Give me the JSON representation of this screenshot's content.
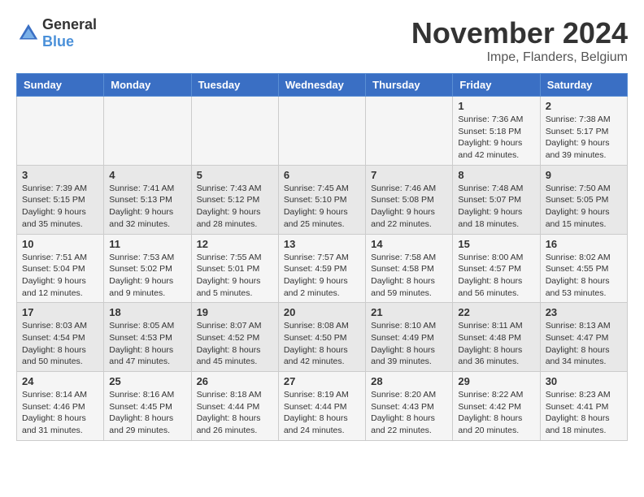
{
  "header": {
    "logo_general": "General",
    "logo_blue": "Blue",
    "title": "November 2024",
    "location": "Impe, Flanders, Belgium"
  },
  "days_of_week": [
    "Sunday",
    "Monday",
    "Tuesday",
    "Wednesday",
    "Thursday",
    "Friday",
    "Saturday"
  ],
  "weeks": [
    [
      {
        "day": "",
        "info": ""
      },
      {
        "day": "",
        "info": ""
      },
      {
        "day": "",
        "info": ""
      },
      {
        "day": "",
        "info": ""
      },
      {
        "day": "",
        "info": ""
      },
      {
        "day": "1",
        "info": "Sunrise: 7:36 AM\nSunset: 5:18 PM\nDaylight: 9 hours and 42 minutes."
      },
      {
        "day": "2",
        "info": "Sunrise: 7:38 AM\nSunset: 5:17 PM\nDaylight: 9 hours and 39 minutes."
      }
    ],
    [
      {
        "day": "3",
        "info": "Sunrise: 7:39 AM\nSunset: 5:15 PM\nDaylight: 9 hours and 35 minutes."
      },
      {
        "day": "4",
        "info": "Sunrise: 7:41 AM\nSunset: 5:13 PM\nDaylight: 9 hours and 32 minutes."
      },
      {
        "day": "5",
        "info": "Sunrise: 7:43 AM\nSunset: 5:12 PM\nDaylight: 9 hours and 28 minutes."
      },
      {
        "day": "6",
        "info": "Sunrise: 7:45 AM\nSunset: 5:10 PM\nDaylight: 9 hours and 25 minutes."
      },
      {
        "day": "7",
        "info": "Sunrise: 7:46 AM\nSunset: 5:08 PM\nDaylight: 9 hours and 22 minutes."
      },
      {
        "day": "8",
        "info": "Sunrise: 7:48 AM\nSunset: 5:07 PM\nDaylight: 9 hours and 18 minutes."
      },
      {
        "day": "9",
        "info": "Sunrise: 7:50 AM\nSunset: 5:05 PM\nDaylight: 9 hours and 15 minutes."
      }
    ],
    [
      {
        "day": "10",
        "info": "Sunrise: 7:51 AM\nSunset: 5:04 PM\nDaylight: 9 hours and 12 minutes."
      },
      {
        "day": "11",
        "info": "Sunrise: 7:53 AM\nSunset: 5:02 PM\nDaylight: 9 hours and 9 minutes."
      },
      {
        "day": "12",
        "info": "Sunrise: 7:55 AM\nSunset: 5:01 PM\nDaylight: 9 hours and 5 minutes."
      },
      {
        "day": "13",
        "info": "Sunrise: 7:57 AM\nSunset: 4:59 PM\nDaylight: 9 hours and 2 minutes."
      },
      {
        "day": "14",
        "info": "Sunrise: 7:58 AM\nSunset: 4:58 PM\nDaylight: 8 hours and 59 minutes."
      },
      {
        "day": "15",
        "info": "Sunrise: 8:00 AM\nSunset: 4:57 PM\nDaylight: 8 hours and 56 minutes."
      },
      {
        "day": "16",
        "info": "Sunrise: 8:02 AM\nSunset: 4:55 PM\nDaylight: 8 hours and 53 minutes."
      }
    ],
    [
      {
        "day": "17",
        "info": "Sunrise: 8:03 AM\nSunset: 4:54 PM\nDaylight: 8 hours and 50 minutes."
      },
      {
        "day": "18",
        "info": "Sunrise: 8:05 AM\nSunset: 4:53 PM\nDaylight: 8 hours and 47 minutes."
      },
      {
        "day": "19",
        "info": "Sunrise: 8:07 AM\nSunset: 4:52 PM\nDaylight: 8 hours and 45 minutes."
      },
      {
        "day": "20",
        "info": "Sunrise: 8:08 AM\nSunset: 4:50 PM\nDaylight: 8 hours and 42 minutes."
      },
      {
        "day": "21",
        "info": "Sunrise: 8:10 AM\nSunset: 4:49 PM\nDaylight: 8 hours and 39 minutes."
      },
      {
        "day": "22",
        "info": "Sunrise: 8:11 AM\nSunset: 4:48 PM\nDaylight: 8 hours and 36 minutes."
      },
      {
        "day": "23",
        "info": "Sunrise: 8:13 AM\nSunset: 4:47 PM\nDaylight: 8 hours and 34 minutes."
      }
    ],
    [
      {
        "day": "24",
        "info": "Sunrise: 8:14 AM\nSunset: 4:46 PM\nDaylight: 8 hours and 31 minutes."
      },
      {
        "day": "25",
        "info": "Sunrise: 8:16 AM\nSunset: 4:45 PM\nDaylight: 8 hours and 29 minutes."
      },
      {
        "day": "26",
        "info": "Sunrise: 8:18 AM\nSunset: 4:44 PM\nDaylight: 8 hours and 26 minutes."
      },
      {
        "day": "27",
        "info": "Sunrise: 8:19 AM\nSunset: 4:44 PM\nDaylight: 8 hours and 24 minutes."
      },
      {
        "day": "28",
        "info": "Sunrise: 8:20 AM\nSunset: 4:43 PM\nDaylight: 8 hours and 22 minutes."
      },
      {
        "day": "29",
        "info": "Sunrise: 8:22 AM\nSunset: 4:42 PM\nDaylight: 8 hours and 20 minutes."
      },
      {
        "day": "30",
        "info": "Sunrise: 8:23 AM\nSunset: 4:41 PM\nDaylight: 8 hours and 18 minutes."
      }
    ]
  ]
}
